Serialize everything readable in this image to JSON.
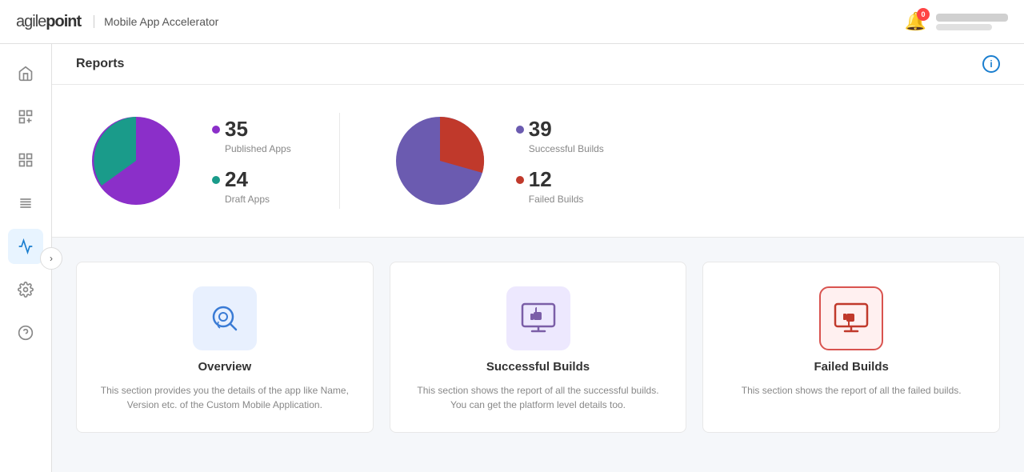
{
  "header": {
    "logo": "agilepoint",
    "app_title": "Mobile App Accelerator",
    "notification_count": "0"
  },
  "sidebar": {
    "items": [
      {
        "id": "home",
        "icon": "🏠",
        "active": false
      },
      {
        "id": "add-widget",
        "icon": "⊞",
        "active": false
      },
      {
        "id": "grid",
        "icon": "▦",
        "active": false
      },
      {
        "id": "list",
        "icon": "☰",
        "active": false
      },
      {
        "id": "reports",
        "icon": "📈",
        "active": true
      },
      {
        "id": "settings",
        "icon": "⚙",
        "active": false
      },
      {
        "id": "help",
        "icon": "?",
        "active": false
      }
    ],
    "collapse_icon": "›"
  },
  "reports": {
    "title": "Reports",
    "chart1": {
      "published_count": "35",
      "published_label": "Published Apps",
      "draft_count": "24",
      "draft_label": "Draft Apps",
      "published_color": "#8B2FC9",
      "draft_color": "#1A9B8A"
    },
    "chart2": {
      "successful_count": "39",
      "successful_label": "Successful Builds",
      "failed_count": "12",
      "failed_label": "Failed Builds",
      "successful_color": "#7B5EA7",
      "failed_color": "#C0392B"
    },
    "cards": [
      {
        "id": "overview",
        "title": "Overview",
        "description": "This section provides you the details of the app like Name, Version etc. of the Custom Mobile Application.",
        "icon_type": "overview"
      },
      {
        "id": "successful-builds",
        "title": "Successful Builds",
        "description": "This section shows the report of all the successful builds. You can get the platform level details too.",
        "icon_type": "success"
      },
      {
        "id": "failed-builds",
        "title": "Failed Builds",
        "description": "This section shows the report of all the failed builds.",
        "icon_type": "failed"
      }
    ]
  }
}
